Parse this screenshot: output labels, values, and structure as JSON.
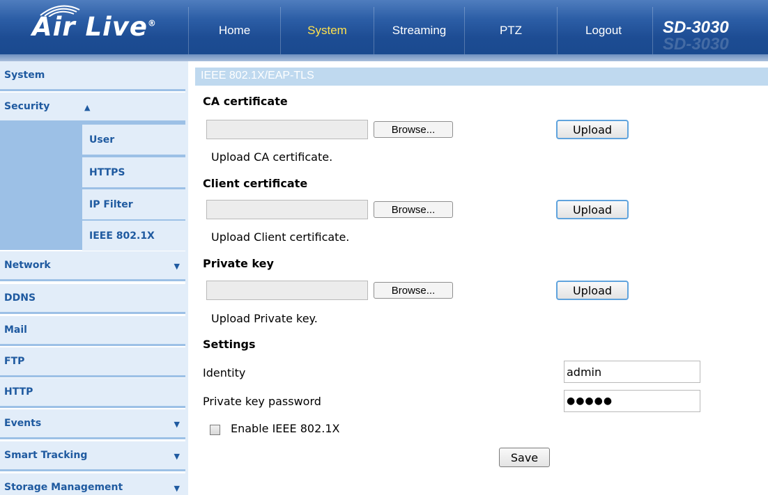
{
  "header": {
    "logo_text": "Air Live",
    "logo_reg": "®",
    "nav": [
      {
        "label": "Home",
        "active": false
      },
      {
        "label": "System",
        "active": true
      },
      {
        "label": "Streaming",
        "active": false
      },
      {
        "label": "PTZ",
        "active": false
      },
      {
        "label": "Logout",
        "active": false
      }
    ],
    "model": "SD-3030",
    "active_color": "#ffe14d"
  },
  "sidebar": {
    "items": [
      {
        "label": "System"
      },
      {
        "label": "Security",
        "expanded": true
      },
      {
        "label": "Network",
        "expandable": true
      },
      {
        "label": "DDNS"
      },
      {
        "label": "Mail"
      },
      {
        "label": "FTP"
      },
      {
        "label": "HTTP"
      },
      {
        "label": "Events",
        "expandable": true
      },
      {
        "label": "Smart Tracking",
        "expandable": true
      },
      {
        "label": "Storage Management",
        "expandable": true
      }
    ],
    "security_sub": [
      {
        "label": "User"
      },
      {
        "label": "HTTPS"
      },
      {
        "label": "IP Filter"
      },
      {
        "label": "IEEE 802.1X",
        "selected": true
      }
    ],
    "arrow_up": "▲",
    "arrow_down": "▼"
  },
  "main": {
    "section_title": "IEEE 802.1X/EAP-TLS",
    "ca": {
      "heading": "CA certificate",
      "browse": "Browse...",
      "upload": "Upload",
      "desc": "Upload CA certificate."
    },
    "client": {
      "heading": "Client certificate",
      "browse": "Browse...",
      "upload": "Upload",
      "desc": "Upload Client certificate."
    },
    "private": {
      "heading": "Private key",
      "browse": "Browse...",
      "upload": "Upload",
      "desc": "Upload Private key."
    },
    "settings": {
      "heading": "Settings",
      "identity_label": "Identity",
      "identity_value": "admin",
      "password_label": "Private key password",
      "password_value": "●●●●●",
      "enable_label": "Enable IEEE 802.1X",
      "enable_checked": false
    },
    "save": "Save"
  }
}
